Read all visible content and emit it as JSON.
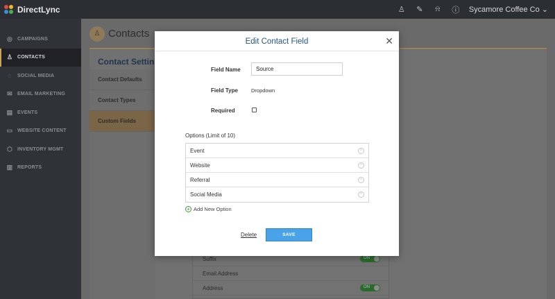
{
  "app": {
    "name": "DirectLync",
    "account": "Sycamore Coffee Co"
  },
  "topbar": {
    "icons": [
      "user-icon",
      "edit-icon",
      "bell-icon",
      "help-icon"
    ],
    "account_caret": "⌄"
  },
  "sidebar": {
    "items": [
      {
        "label": "CAMPAIGNS",
        "icon": "target-icon",
        "glyph": "◎",
        "active": false
      },
      {
        "label": "CONTACTS",
        "icon": "contact-icon",
        "glyph": "♙",
        "active": true
      },
      {
        "label": "SOCIAL MEDIA",
        "icon": "chat-icon",
        "glyph": "◌",
        "active": false
      },
      {
        "label": "EMAIL MARKETING",
        "icon": "envelope-icon",
        "glyph": "✉",
        "active": false
      },
      {
        "label": "EVENTS",
        "icon": "calendar-icon",
        "glyph": "▤",
        "active": false
      },
      {
        "label": "WEBSITE CONTENT",
        "icon": "monitor-icon",
        "glyph": "▭",
        "active": false
      },
      {
        "label": "INVENTORY MGMT",
        "icon": "box-icon",
        "glyph": "⬡",
        "active": false
      },
      {
        "label": "REPORTS",
        "icon": "bar-chart-icon",
        "glyph": "▥",
        "active": false
      }
    ]
  },
  "page": {
    "title": "Contacts",
    "settings_title": "Contact Settings",
    "tabs": [
      {
        "label": "Contact Defaults",
        "active": false
      },
      {
        "label": "Contact Types",
        "active": false
      },
      {
        "label": "Custom Fields",
        "active": true
      }
    ],
    "background_fields": [
      {
        "label": "Suffix",
        "toggle": "ON"
      },
      {
        "label": "Email Address",
        "toggle": ""
      },
      {
        "label": "Address",
        "toggle": "ON"
      }
    ]
  },
  "modal": {
    "title": "Edit Contact Field",
    "close_glyph": "✕",
    "field_name_label": "Field Name",
    "field_name_value": "Source",
    "field_type_label": "Field Type",
    "field_type_value": "Dropdown",
    "required_label": "Required",
    "required_checked": false,
    "options_label": "Options (Limit of 10)",
    "options": [
      "Event",
      "Website",
      "Referral",
      "Social Media"
    ],
    "add_option_label": "Add New Option",
    "delete_label": "Delete",
    "save_label": "SAVE"
  },
  "colors": {
    "accent": "#d0a35a",
    "save_blue": "#4aa3e8",
    "title_blue": "#24558a",
    "add_green": "#3c9a3c"
  }
}
